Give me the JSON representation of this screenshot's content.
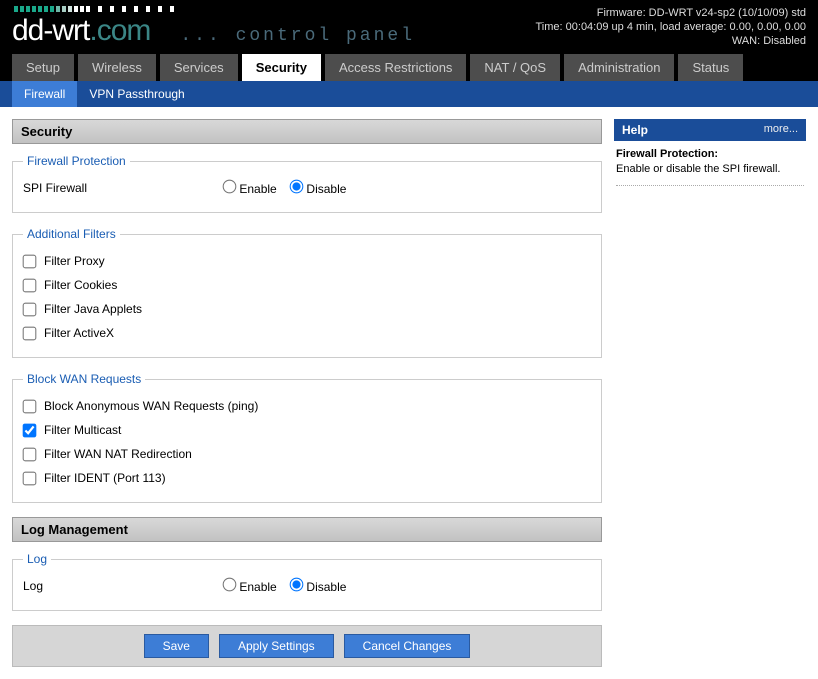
{
  "header": {
    "firmware": "Firmware: DD-WRT v24-sp2 (10/10/09) std",
    "time": "Time: 00:04:09 up 4 min, load average: 0.00, 0.00, 0.00",
    "wan": "WAN: Disabled",
    "brand_main": "dd-wrt",
    "brand_suffix": ".com",
    "cp_label": "... control panel"
  },
  "tabs": {
    "items": [
      {
        "label": "Setup",
        "active": false
      },
      {
        "label": "Wireless",
        "active": false
      },
      {
        "label": "Services",
        "active": false
      },
      {
        "label": "Security",
        "active": true
      },
      {
        "label": "Access Restrictions",
        "active": false
      },
      {
        "label": "NAT / QoS",
        "active": false
      },
      {
        "label": "Administration",
        "active": false
      },
      {
        "label": "Status",
        "active": false
      }
    ]
  },
  "subtabs": {
    "items": [
      {
        "label": "Firewall",
        "active": true
      },
      {
        "label": "VPN Passthrough",
        "active": false
      }
    ]
  },
  "sections": {
    "security_title": "Security",
    "log_title": "Log Management"
  },
  "fieldsets": {
    "firewall_protection": {
      "legend": "Firewall Protection",
      "rows": {
        "spi": {
          "label": "SPI Firewall",
          "enable": "Enable",
          "disable": "Disable",
          "value": "disable"
        }
      }
    },
    "additional_filters": {
      "legend": "Additional Filters",
      "items": [
        {
          "label": "Filter Proxy",
          "checked": false
        },
        {
          "label": "Filter Cookies",
          "checked": false
        },
        {
          "label": "Filter Java Applets",
          "checked": false
        },
        {
          "label": "Filter ActiveX",
          "checked": false
        }
      ]
    },
    "block_wan": {
      "legend": "Block WAN Requests",
      "items": [
        {
          "label": "Block Anonymous WAN Requests (ping)",
          "checked": false
        },
        {
          "label": "Filter Multicast",
          "checked": true
        },
        {
          "label": "Filter WAN NAT Redirection",
          "checked": false
        },
        {
          "label": "Filter IDENT (Port 113)",
          "checked": false
        }
      ]
    },
    "log": {
      "legend": "Log",
      "rows": {
        "log": {
          "label": "Log",
          "enable": "Enable",
          "disable": "Disable",
          "value": "disable"
        }
      }
    }
  },
  "buttons": {
    "save": "Save",
    "apply": "Apply Settings",
    "cancel": "Cancel Changes"
  },
  "help": {
    "title": "Help",
    "more": "more...",
    "heading": "Firewall Protection:",
    "text": "Enable or disable the SPI firewall."
  },
  "bar_colors": [
    "#1aa88a",
    "#1aa88a",
    "#1aa88a",
    "#1aa88a",
    "#1aa88a",
    "#1aa88a",
    "#1aa88a",
    "#6fb8a8",
    "#a8cec4",
    "#d0e3de",
    "#fff",
    "#fff",
    "#fff",
    "#000",
    "#fff",
    "#000",
    "#fff",
    "#000",
    "#fff",
    "#000",
    "#fff",
    "#000",
    "#fff",
    "#000",
    "#fff",
    "#000",
    "#fff"
  ]
}
